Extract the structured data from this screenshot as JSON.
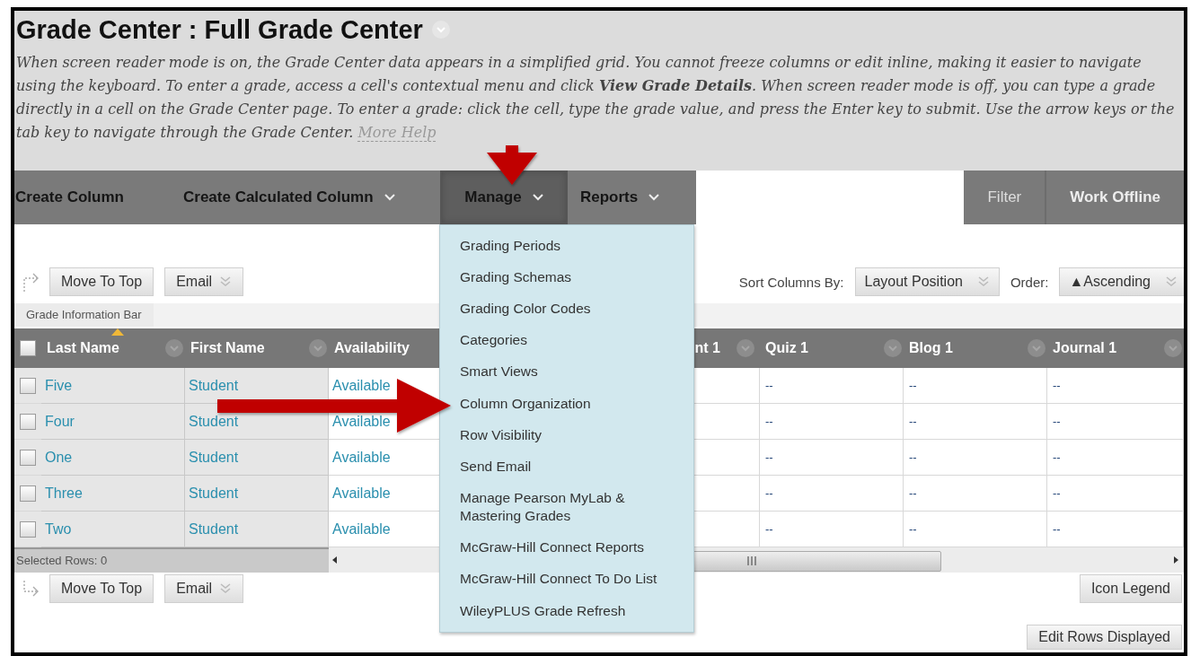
{
  "header": {
    "title": "Grade Center : Full Grade Center",
    "description": "When screen reader mode is on, the Grade Center data appears in a simplified grid. You cannot freeze columns or edit inline, making it easier to navigate using the keyboard. To enter a grade, access a cell's contextual menu and click **View Grade Details**. When screen reader mode is off, you can type a grade directly in a cell on the Grade Center page. To enter a grade: click the cell, type the grade value, and press the Enter key to submit. Use the arrow keys or the tab key to navigate through the Grade Center.",
    "more_help": "More Help"
  },
  "toolbar": {
    "left": [
      {
        "label": "Create Column",
        "caret": false,
        "selected": false
      },
      {
        "label": "Create Calculated Column",
        "caret": true,
        "selected": false
      },
      {
        "label": "Manage",
        "caret": true,
        "selected": true
      },
      {
        "label": "Reports",
        "caret": true,
        "selected": false
      }
    ],
    "right": [
      "Filter",
      "Work Offline"
    ]
  },
  "manage_menu": {
    "items": [
      "Grading Periods",
      "Grading Schemas",
      "Grading Color Codes",
      "Categories",
      "Smart Views",
      "Column Organization",
      "Row Visibility",
      "Send Email",
      "Manage Pearson MyLab & Mastering Grades",
      "McGraw-Hill Connect Reports",
      "McGraw-Hill Connect To Do List",
      "WileyPLUS Grade Refresh"
    ]
  },
  "top_actions": {
    "buttons": [
      {
        "label": "Move To Top",
        "kind": "button"
      },
      {
        "label": "Email",
        "kind": "dropdown"
      }
    ],
    "sort_label": "Sort Columns By:",
    "sort_value": "Layout Position",
    "order_label": "Order:",
    "order_value": "▲Ascending"
  },
  "info_bar": "Grade Information Bar",
  "table": {
    "select_all_checked": false,
    "columns": [
      {
        "label": "Last Name",
        "kind": "link",
        "frozen": true,
        "sorted": true
      },
      {
        "label": "First Name",
        "kind": "link",
        "frozen": true,
        "sorted": false
      },
      {
        "label": "Availability",
        "kind": "link",
        "frozen": false,
        "sorted": false
      },
      {
        "label": "nt 1",
        "kind": "partial",
        "frozen": false,
        "sorted": false
      },
      {
        "label": "Quiz 1",
        "kind": "grade",
        "frozen": false,
        "sorted": false
      },
      {
        "label": "Blog 1",
        "kind": "grade",
        "frozen": false,
        "sorted": false
      },
      {
        "label": "Journal 1",
        "kind": "grade",
        "frozen": false,
        "sorted": false
      }
    ],
    "rows": [
      {
        "checked": false,
        "cells": [
          "Five",
          "Student",
          "Available",
          "",
          "--",
          "--",
          "--"
        ]
      },
      {
        "checked": false,
        "cells": [
          "Four",
          "Student",
          "Available",
          "",
          "--",
          "--",
          "--"
        ]
      },
      {
        "checked": false,
        "cells": [
          "One",
          "Student",
          "Available",
          "",
          "--",
          "--",
          "--"
        ]
      },
      {
        "checked": false,
        "cells": [
          "Three",
          "Student",
          "Available",
          "",
          "--",
          "--",
          "--"
        ]
      },
      {
        "checked": false,
        "cells": [
          "Two",
          "Student",
          "Available",
          "",
          "--",
          "--",
          "--"
        ]
      }
    ],
    "selected_rows": "Selected Rows: 0"
  },
  "bottom_actions": {
    "buttons": [
      {
        "label": "Move To Top",
        "kind": "button"
      },
      {
        "label": "Email",
        "kind": "dropdown"
      }
    ],
    "icon_legend": "Icon Legend",
    "edit_rows": "Edit Rows Displayed"
  }
}
